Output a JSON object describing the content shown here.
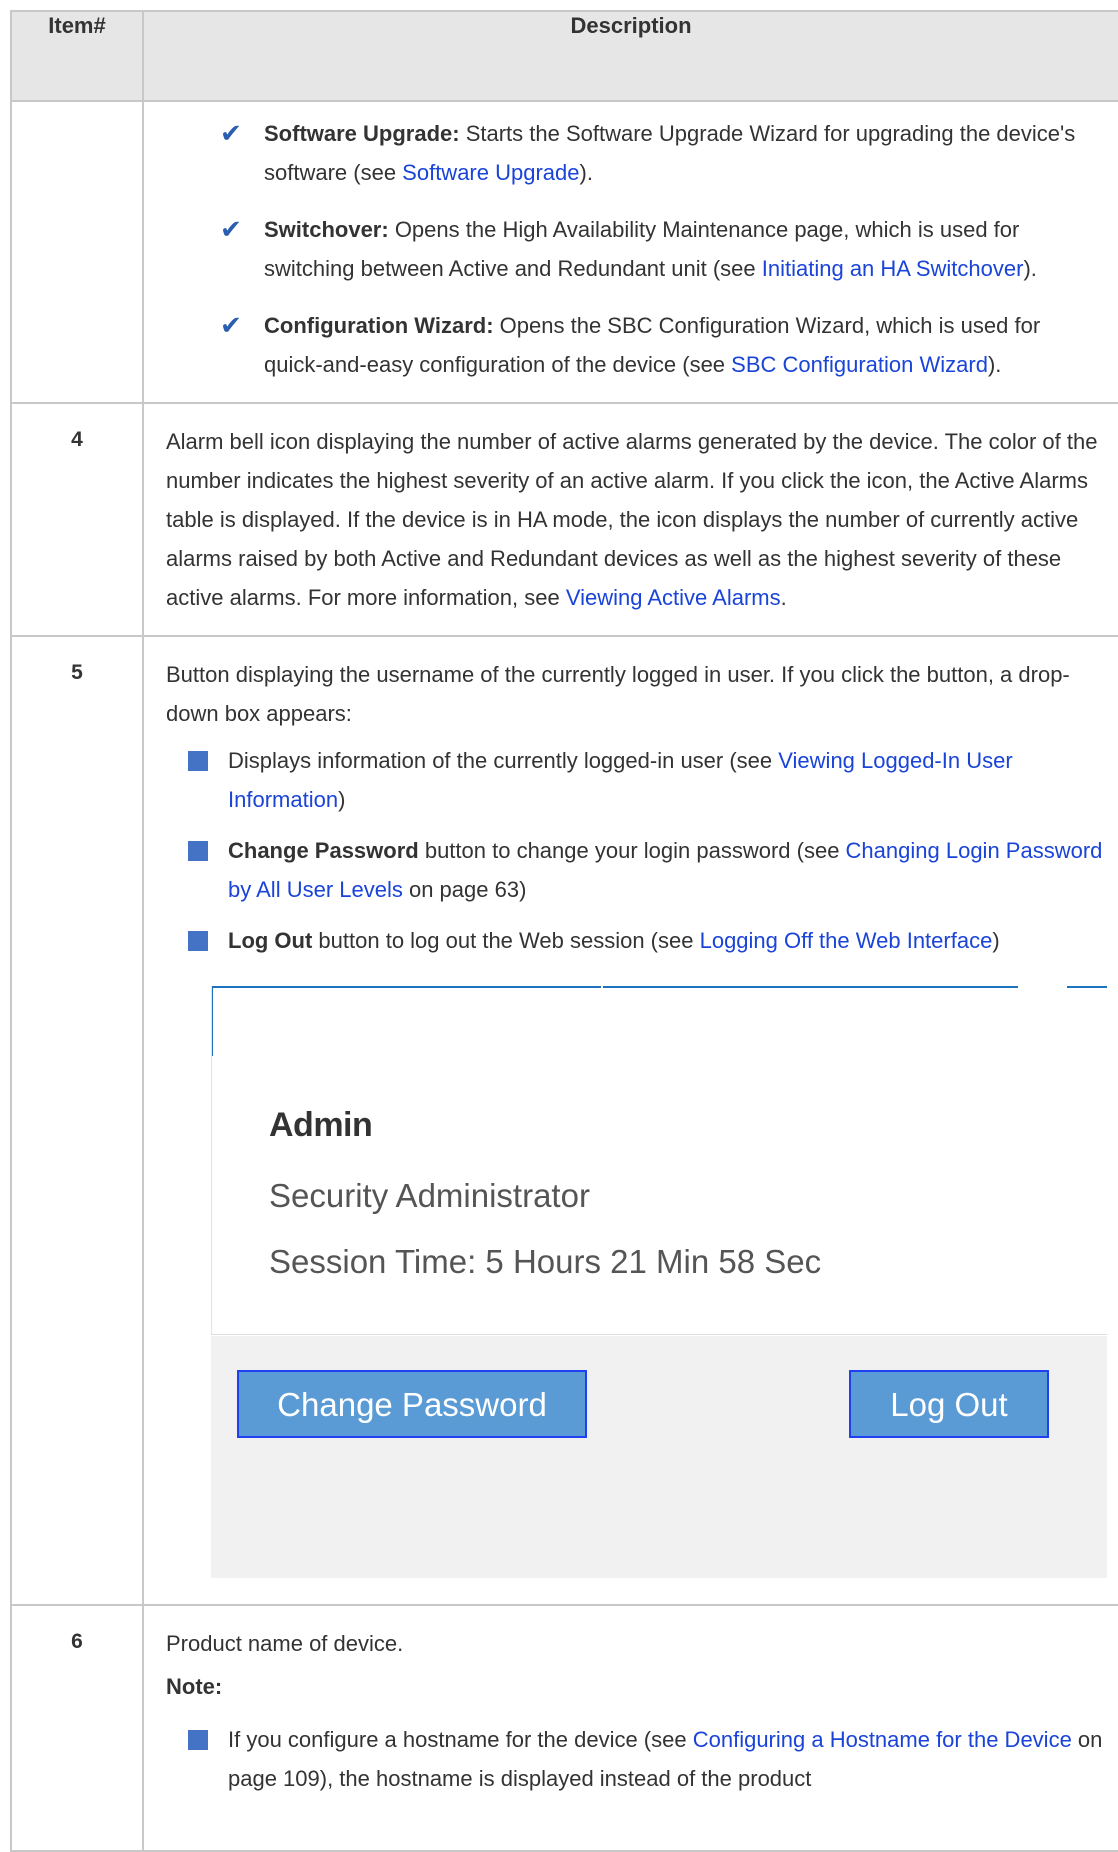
{
  "table": {
    "headers": {
      "item": "Item#",
      "description": "Description"
    }
  },
  "row_cont": {
    "bullets": [
      {
        "bold": "Software Upgrade:",
        "text": " Starts the Software Upgrade Wizard for upgrading the device's software (see ",
        "link": "Software Upgrade",
        "after": ")."
      },
      {
        "bold": "Switchover:",
        "text": " Opens the High Availability Maintenance page, which is used for switching between Active and Redundant unit (see ",
        "link": "Initiating an HA Switchover",
        "after": ")."
      },
      {
        "bold": "Configuration Wizard:",
        "text": " Opens the SBC Configuration Wizard, which is used for quick-and-easy configuration of the device (see ",
        "link": "SBC Configuration Wizard",
        "after": ")."
      }
    ]
  },
  "row4": {
    "item": "4",
    "text": "Alarm bell icon displaying the number of active alarms generated by the device. The color of the number indicates the highest severity of an active alarm. If you click the icon, the Active Alarms table is displayed. If the device is in HA mode, the icon displays the number of currently active alarms raised by both Active and Redundant devices as well as the highest severity of these active alarms. For more information, see ",
    "link": "Viewing Active Alarms",
    "after": "."
  },
  "row5": {
    "item": "5",
    "intro": "Button displaying the username of the currently logged in user. If you click the button, a drop-down box appears:",
    "bullets": [
      {
        "bold": "",
        "text": "Displays information of the currently logged-in user (see ",
        "link": "Viewing Logged-In User Information",
        "after": ")"
      },
      {
        "bold": "Change Password",
        "text": " button to change your login password (see ",
        "link": "Changing Login Password by All User Levels",
        "after": " on page 63)"
      },
      {
        "bold": "Log Out",
        "text": " button to log out the Web session (see ",
        "link": "Logging Off the Web Interface",
        "after": ")"
      }
    ],
    "panel": {
      "username": "Admin",
      "role": "Security Administrator",
      "session": "Session Time: 5 Hours 21 Min 58 Sec",
      "change_password": "Change Password",
      "log_out": "Log Out"
    }
  },
  "row6": {
    "item": "6",
    "text": "Product name of device.",
    "note": "Note:",
    "bullets": [
      {
        "text": "If you configure a hostname for the device (see ",
        "link": "Configuring a Hostname for the Device",
        "after": " on page 109), the hostname is displayed instead of the product"
      }
    ]
  },
  "colors": {
    "link": "#1a44d8",
    "bullet": "#4472c4",
    "check": "#2a5fb0",
    "button": "#5b9bd5"
  }
}
